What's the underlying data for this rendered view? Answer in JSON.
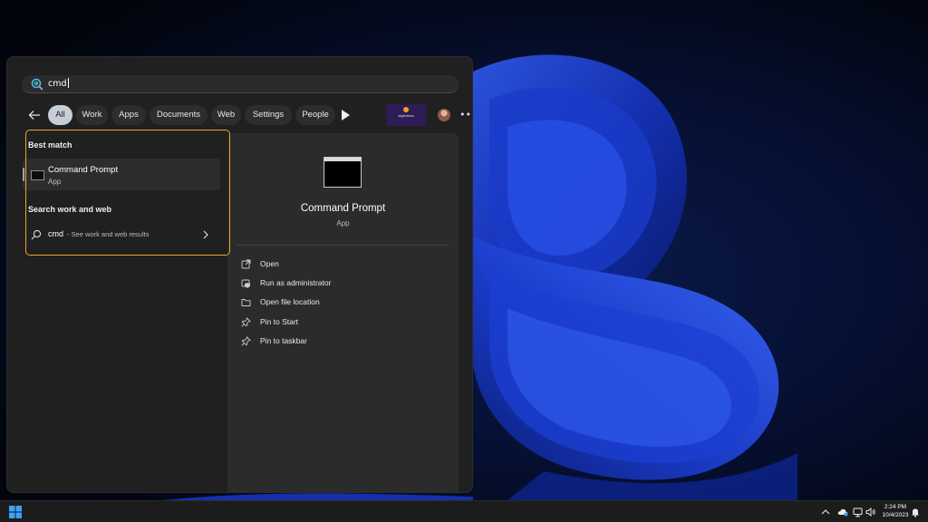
{
  "search": {
    "query": "cmd"
  },
  "filters": [
    {
      "label": "All",
      "active": true
    },
    {
      "label": "Work",
      "active": false
    },
    {
      "label": "Apps",
      "active": false
    },
    {
      "label": "Documents",
      "active": false
    },
    {
      "label": "Web",
      "active": false
    },
    {
      "label": "Settings",
      "active": false
    },
    {
      "label": "People",
      "active": false
    }
  ],
  "ad_badge": {
    "label": "digitalless"
  },
  "best_match": {
    "section_title": "Best match",
    "name": "Command Prompt",
    "type": "App"
  },
  "web_section": {
    "section_title": "Search work and web",
    "query": "cmd",
    "suffix": "- See work and web results"
  },
  "preview": {
    "title": "Command Prompt",
    "type": "App",
    "actions": [
      {
        "label": "Open",
        "icon": "open-external-icon"
      },
      {
        "label": "Run as administrator",
        "icon": "shield-admin-icon"
      },
      {
        "label": "Open file location",
        "icon": "folder-icon"
      },
      {
        "label": "Pin to Start",
        "icon": "pin-icon"
      },
      {
        "label": "Pin to taskbar",
        "icon": "pin-icon"
      }
    ]
  },
  "taskbar": {
    "time": "2:24 PM",
    "date": "10/4/2023"
  },
  "colors": {
    "highlight": "#f0a52a",
    "panel": "#202020",
    "preview": "#2b2b2b",
    "active_chip": "#c7ced6"
  }
}
